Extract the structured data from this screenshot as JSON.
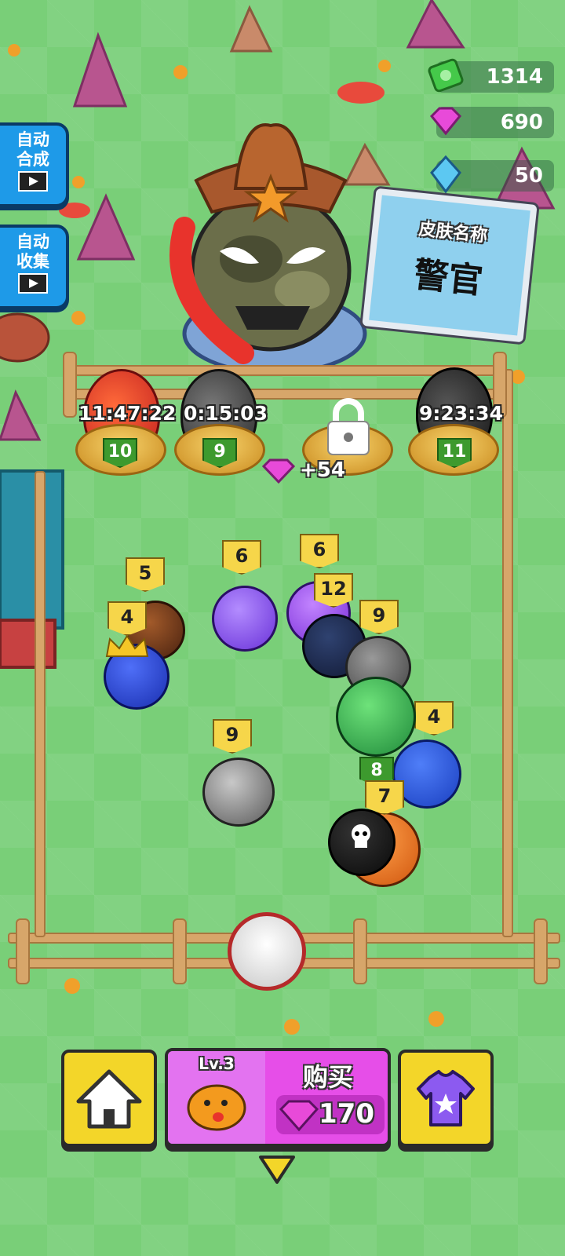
{
  "currency": {
    "cash": "1314",
    "gems": "690",
    "crystals": "50"
  },
  "side_buttons": {
    "auto_merge": "自动\n合成",
    "auto_collect": "自动\n收集"
  },
  "skin_sign": {
    "title": "皮肤名称",
    "name": "警官"
  },
  "nests": [
    {
      "timer": "11:47:22",
      "level": "10"
    },
    {
      "timer": "0:15:03",
      "level": "9"
    },
    {
      "timer": "",
      "level": ""
    },
    {
      "timer": "9:23:34",
      "level": "11"
    }
  ],
  "unlock_reward": "+54",
  "creatures": [
    {
      "level": "5"
    },
    {
      "level": "4"
    },
    {
      "level": "6"
    },
    {
      "level": "6"
    },
    {
      "level": "12"
    },
    {
      "level": "9"
    },
    {
      "level": "9"
    },
    {
      "level": "4"
    },
    {
      "level": "8"
    },
    {
      "level": "7"
    }
  ],
  "bottom_bar": {
    "buy_level": "Lv.3",
    "buy_label": "购买",
    "buy_price": "170"
  },
  "colors": {
    "grass": "#79cf78",
    "buy_button": "#e64ee8",
    "side_button": "#1e9ae8",
    "yellow_button": "#f3d629"
  },
  "icons": [
    "cash-icon",
    "gem-icon",
    "crystal-icon",
    "film-icon",
    "lock-icon",
    "home-icon",
    "shirt-icon",
    "down-arrow-icon"
  ]
}
